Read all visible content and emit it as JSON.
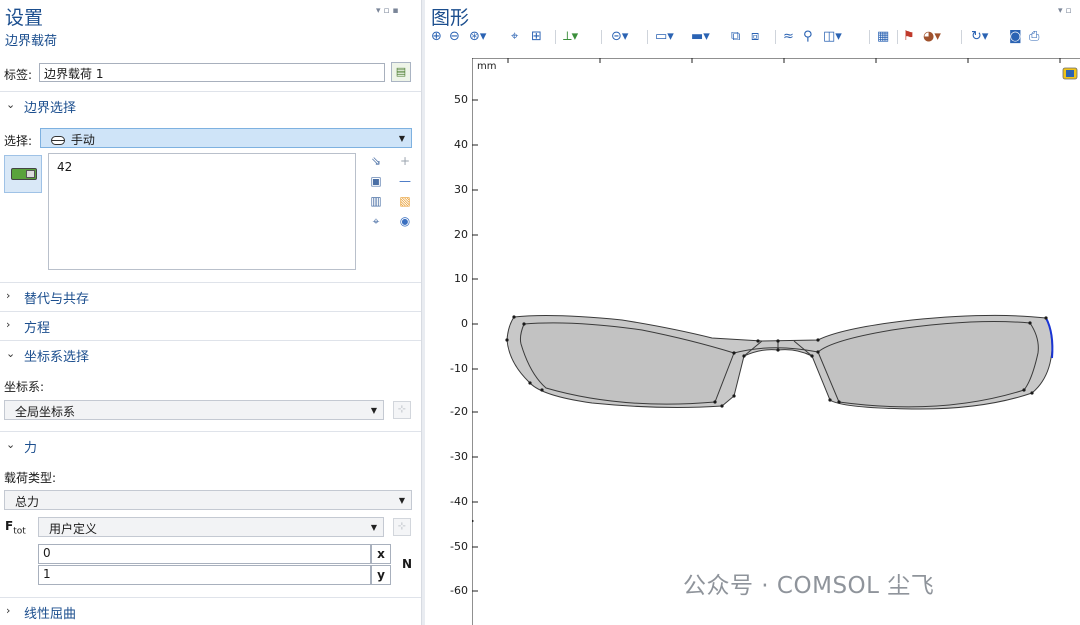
{
  "settings": {
    "title": "设置",
    "subtitle": "边界载荷",
    "label_caption": "标签:",
    "label_value": "边界载荷 1",
    "sections": {
      "boundary_selection": "边界选择",
      "override": "替代与共存",
      "equation": "方程",
      "coord_selection": "坐标系选择",
      "force": "力",
      "linear_buckling": "线性屈曲"
    },
    "selection_caption": "选择:",
    "selection_value": "手动",
    "selected_items": [
      "42"
    ],
    "coord_caption": "坐标系:",
    "coord_value": "全局坐标系",
    "load_type_caption": "载荷类型:",
    "load_type_value": "总力",
    "ftot_caption": "F",
    "ftot_sub": "tot",
    "ftot_mode": "用户定义",
    "force_x": "0",
    "force_y": "1",
    "x_label": "x",
    "y_label": "y",
    "unit": "N"
  },
  "graphics": {
    "title": "图形",
    "axis_unit": "mm",
    "y_ticks": [
      "50",
      "40",
      "30",
      "20",
      "10",
      "0",
      "-10",
      "-20",
      "-30",
      "-40",
      "-50",
      "-60"
    ],
    "watermark": "公众号 · COMSOL 尘飞"
  },
  "colors": {
    "accent": "#1b4e8e",
    "geometry_fill": "#c8c8c8",
    "geometry_stroke": "#3a3a3a",
    "selected_edge": "#1a35d4",
    "selection_highlight": "#cfe4f8"
  }
}
